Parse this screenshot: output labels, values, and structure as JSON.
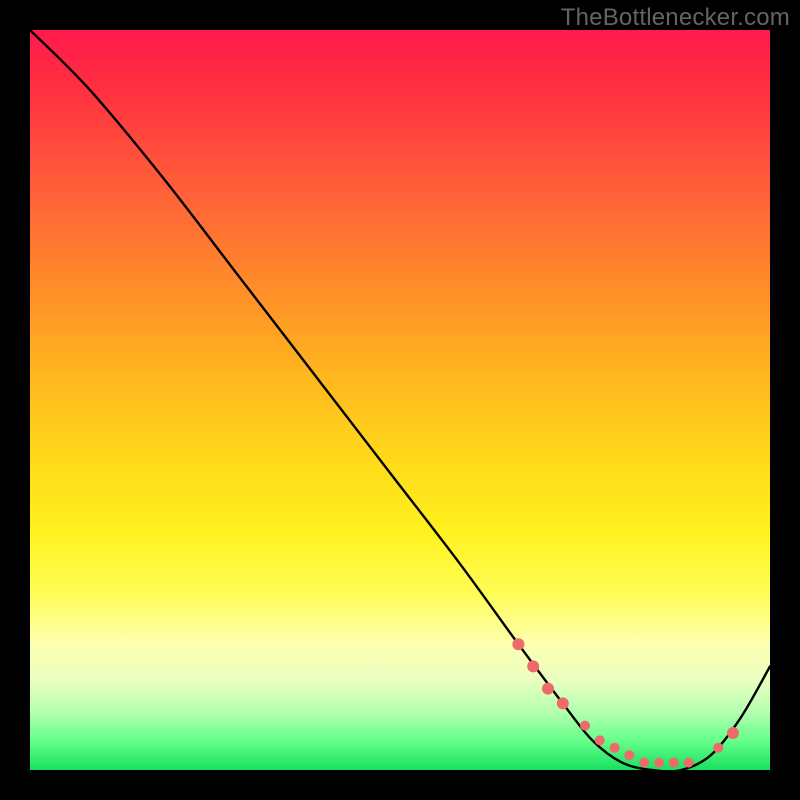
{
  "watermark": "TheBottlenecker.com",
  "chart_data": {
    "type": "line",
    "title": "",
    "xlabel": "",
    "ylabel": "",
    "xlim": [
      0,
      100
    ],
    "ylim": [
      0,
      100
    ],
    "series": [
      {
        "name": "curve",
        "x": [
          0,
          8,
          18,
          28,
          38,
          48,
          58,
          66,
          72,
          76,
          80,
          84,
          88,
          92,
          96,
          100
        ],
        "y": [
          100,
          92,
          80,
          67,
          54,
          41,
          28,
          17,
          9,
          4,
          1,
          0,
          0,
          2,
          7,
          14
        ]
      }
    ],
    "markers": {
      "name": "dots",
      "color": "#ef6a6a",
      "x": [
        66,
        68,
        70,
        72,
        75,
        77,
        79,
        81,
        83,
        85,
        87,
        89,
        93,
        95
      ],
      "y": [
        17,
        14,
        11,
        9,
        6,
        4,
        3,
        2,
        1,
        1,
        1,
        1,
        3,
        5
      ],
      "r": [
        6,
        6,
        6,
        6,
        5,
        5,
        5,
        5,
        5,
        5,
        5,
        5,
        5,
        6
      ]
    },
    "gradient_stops": [
      {
        "pct": 0,
        "color": "#ff1a4d"
      },
      {
        "pct": 50,
        "color": "#ffd000"
      },
      {
        "pct": 80,
        "color": "#ffff80"
      },
      {
        "pct": 100,
        "color": "#18e060"
      }
    ]
  }
}
